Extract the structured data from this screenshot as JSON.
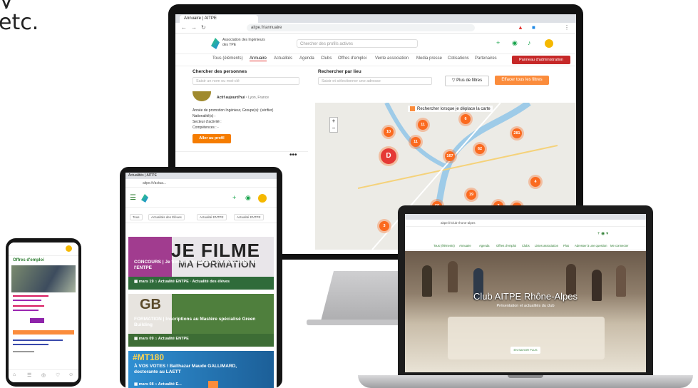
{
  "intro": {
    "line1": "y",
    "line2": "etc."
  },
  "monitor": {
    "tab_title": "Annuaire | AITPE",
    "url": "aitpe.fr/annuaire",
    "logo_text": "Association des Ingénieurs des TPE",
    "search_placeholder": "Chercher des profils actives",
    "menu": [
      "Tous (éléments)",
      "Annuaire",
      "Actualités",
      "Agenda",
      "Clubs",
      "Offres d'emploi",
      "Vente association",
      "Media presse",
      "Cotisations",
      "Partenaires"
    ],
    "admin_button": "Panneau d'administration",
    "people_label": "Chercher des personnes",
    "people_placeholder": "Saisir un nom ou mot-clé",
    "place_label": "Rechercher par lieu",
    "place_placeholder": "Saisir et sélectionner une adresse",
    "filter_button": "Plus de filtres",
    "map_button": "Effacer tous les filtres",
    "card": {
      "active": "Actif aujourd'hui",
      "location": "Lyon, France",
      "line1": "Année de promotion Ingénieur, Groupe(s): (vérifier)",
      "line2": "Nationalité(s) :",
      "line3": "Secteur d'activité :",
      "line4": "Compétences : -",
      "button": "Aller au profil"
    },
    "map_checkbox": "Rechercher lorsque je déplace la carte",
    "pins": [
      "10",
      "11",
      "11",
      "6",
      "281",
      "D",
      "167",
      "62",
      "4",
      "19",
      "60",
      "3",
      "120",
      "3"
    ]
  },
  "tablet": {
    "tab_title": "Actualités | AITPE",
    "url": "aitpe.fr/actua...",
    "filters": [
      "Tous",
      "Actualités des Élèves",
      "Actualité ENTPE",
      "Actualité ENTPE"
    ],
    "cards": [
      {
        "title": "CONCOURS | Je filme ma formation, concours vidéo de l'ENTPE",
        "date": "mars 19",
        "tags": "Actualité ENTPE · Actualité des élèves",
        "overlay": "JE FILME",
        "overlay2": "MA FORMATION"
      },
      {
        "title": "FORMATION | Inscriptions au Mastère spécialisé Green Building",
        "date": "mars 09",
        "tags": "Actualité ENTPE",
        "overlay": "GB",
        "overlay2": ""
      },
      {
        "title": "À VOS VOTES ! Balthazar Maude GALLIMARD, doctorante au LAETT",
        "date": "mars 08",
        "tags": "Actualité E...",
        "overlay": "#MT180",
        "overlay2": ""
      }
    ]
  },
  "phone": {
    "title": "Offres d'emploi",
    "nav": [
      "⌂",
      "☰",
      "◎",
      "♡",
      "☺"
    ]
  },
  "laptop": {
    "url": "aitpe.fr/club-rhone-alpes",
    "menu": [
      "Tous (éléments)",
      "Annuaire",
      "Agenda",
      "Offres d'emploi",
      "Clubs",
      "Listes association",
      "Plus",
      "Adresser à une question",
      "Me connecter"
    ],
    "title": "Club AITPE Rhône-Alpes",
    "subtitle": "Présentation et actualités du club",
    "button": "EN SAVOIR PLUS"
  }
}
